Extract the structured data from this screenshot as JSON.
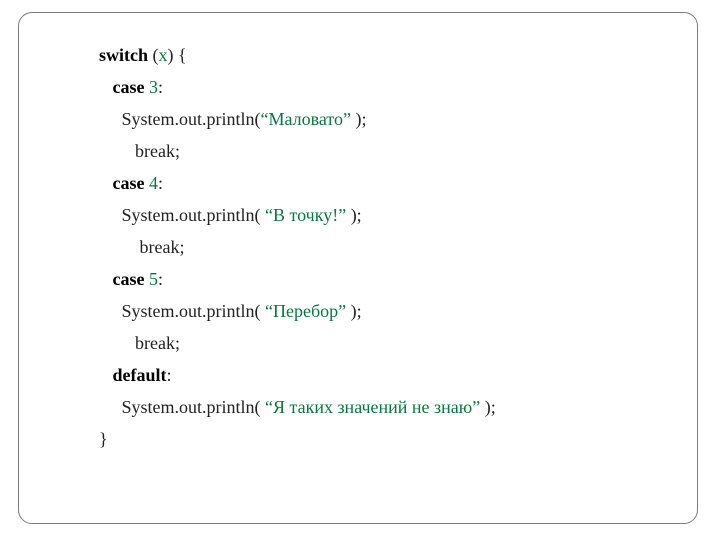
{
  "kw": {
    "switch": "switch",
    "case": "case",
    "break": "break;",
    "default": "default"
  },
  "var": {
    "x": "x"
  },
  "num": {
    "n3": "3",
    "n4": "4",
    "n5": "5"
  },
  "str": {
    "s1": "“Маловато”",
    "s2": "“В точку!”",
    "s3": "“Перебор”",
    "s4": "“Я таких значений не знаю”"
  },
  "call": {
    "println_open": "System.out.println(",
    "println_open_sp": "System.out.println( ",
    "close": " );"
  },
  "sym": {
    "sp_lpar": " (",
    "rpar_sp_lbr": ") {",
    "colon": ":",
    "rbrace": "}"
  }
}
